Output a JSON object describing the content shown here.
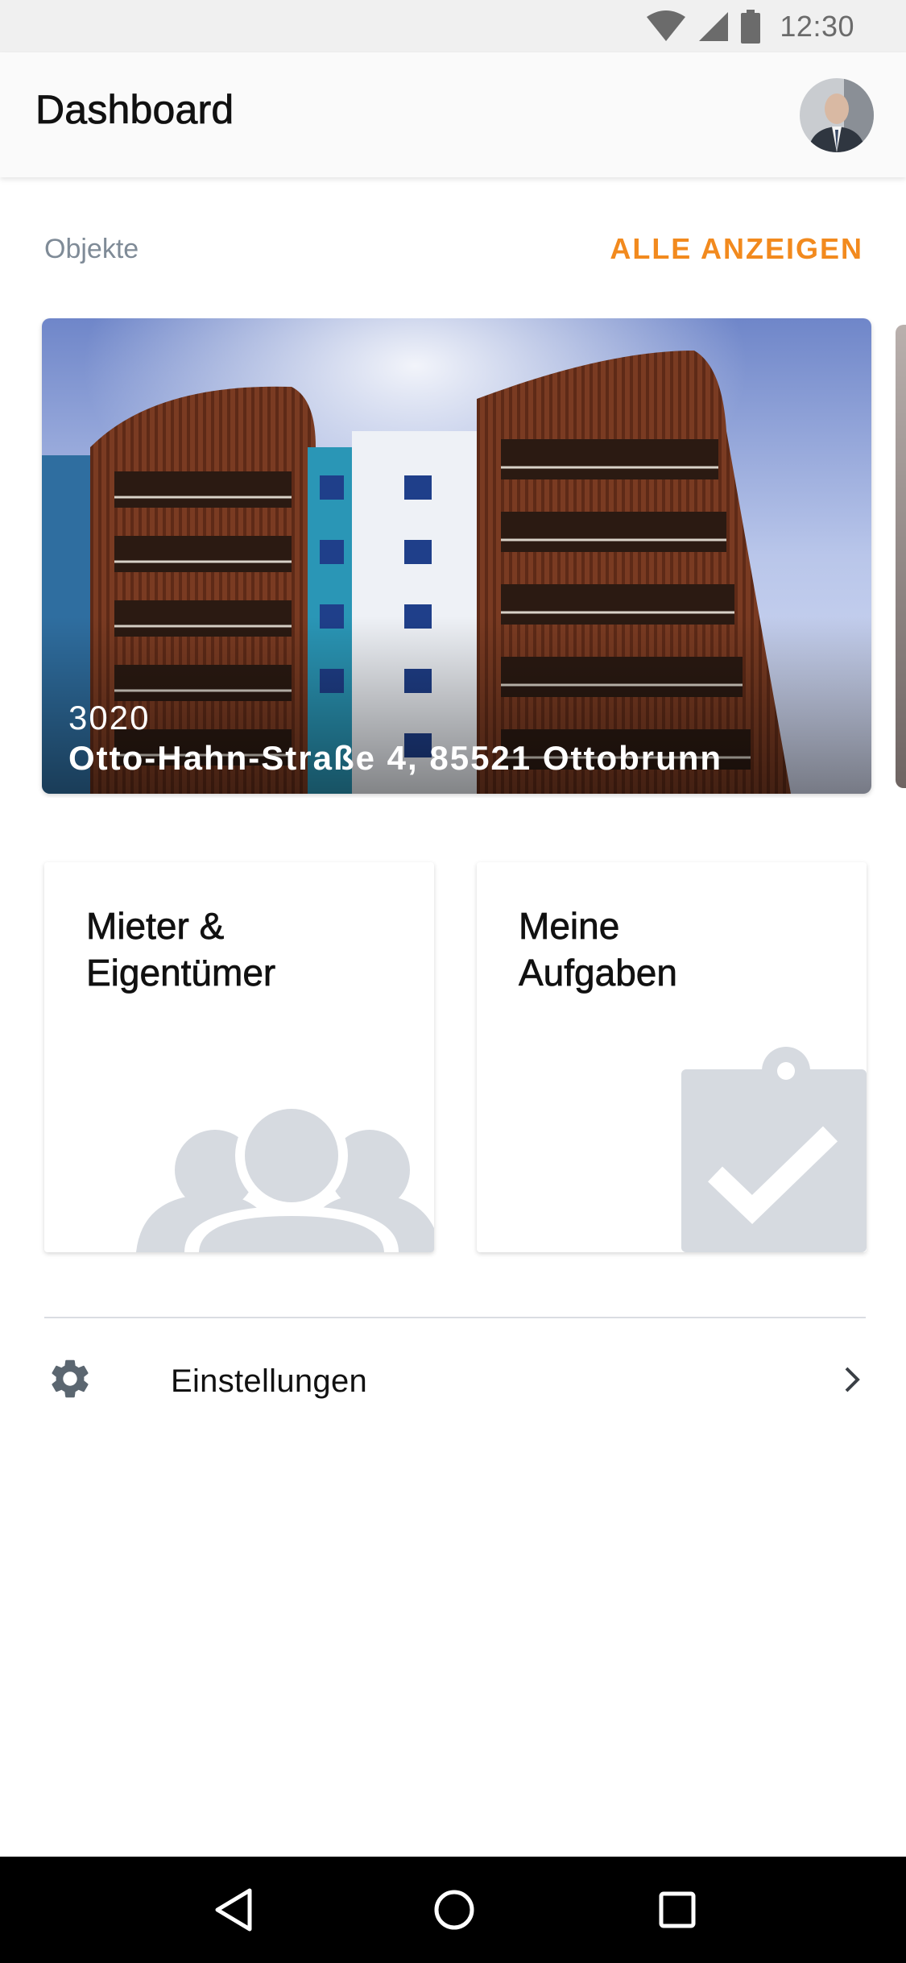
{
  "status_bar": {
    "time": "12:30",
    "icons": [
      "wifi-icon",
      "cell-signal-icon",
      "battery-icon"
    ]
  },
  "app_bar": {
    "title": "Dashboard",
    "avatar": "user-avatar"
  },
  "objects_section": {
    "label": "Objekte",
    "link": "ALLE ANZEIGEN",
    "accent_color": "#f28a1e",
    "cards": [
      {
        "id": "3020",
        "address": "Otto-Hahn-Straße 4, 85521 Ottobrunn"
      }
    ]
  },
  "tiles": [
    {
      "title": "Mieter &\nEigentümer",
      "icon": "people-icon"
    },
    {
      "title": "Meine\nAufgaben",
      "icon": "clipboard-check-icon"
    }
  ],
  "settings": {
    "label": "Einstellungen",
    "icon": "gear-icon"
  },
  "nav_bar": {
    "buttons": [
      "back-icon",
      "home-icon",
      "recents-icon"
    ]
  }
}
